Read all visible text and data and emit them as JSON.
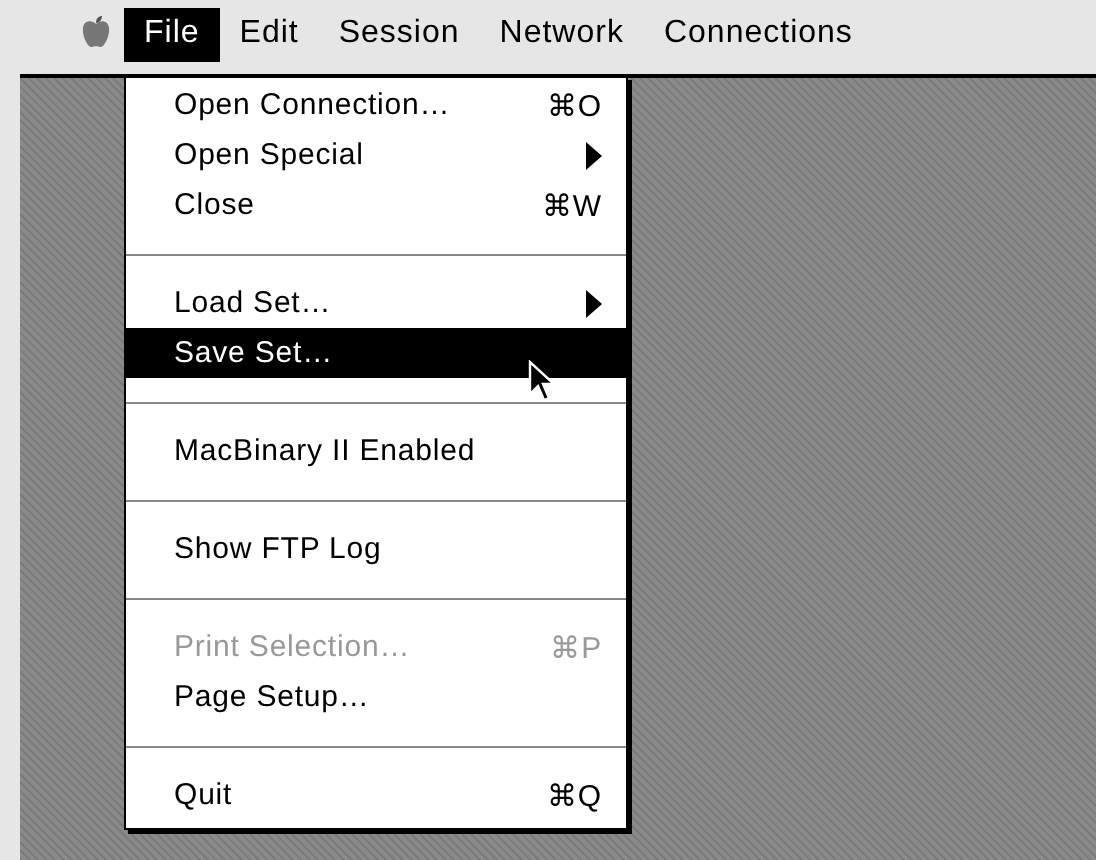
{
  "menu_bar": [
    {
      "label": "File",
      "selected": true
    },
    {
      "label": "Edit",
      "selected": false
    },
    {
      "label": "Session",
      "selected": false
    },
    {
      "label": "Network",
      "selected": false
    },
    {
      "label": "Connections",
      "selected": false
    }
  ],
  "file_menu": [
    {
      "kind": "item",
      "label": "Open Connection…",
      "shortcut": "⌘O",
      "submenu": false,
      "disabled": false,
      "selected": false
    },
    {
      "kind": "item",
      "label": "Open Special",
      "submenu": true,
      "disabled": false,
      "selected": false
    },
    {
      "kind": "item",
      "label": "Close",
      "shortcut": "⌘W",
      "submenu": false,
      "disabled": false,
      "selected": false
    },
    {
      "kind": "separator"
    },
    {
      "kind": "item",
      "label": "Load Set…",
      "submenu": true,
      "disabled": false,
      "selected": false
    },
    {
      "kind": "item",
      "label": "Save Set…",
      "submenu": false,
      "disabled": false,
      "selected": true
    },
    {
      "kind": "separator"
    },
    {
      "kind": "item",
      "label": "MacBinary II Enabled",
      "submenu": false,
      "disabled": false,
      "selected": false
    },
    {
      "kind": "separator"
    },
    {
      "kind": "item",
      "label": "Show FTP Log",
      "submenu": false,
      "disabled": false,
      "selected": false
    },
    {
      "kind": "separator"
    },
    {
      "kind": "item",
      "label": "Print Selection…",
      "shortcut": "⌘P",
      "submenu": false,
      "disabled": true,
      "selected": false
    },
    {
      "kind": "item",
      "label": "Page Setup…",
      "submenu": false,
      "disabled": false,
      "selected": false
    },
    {
      "kind": "separator"
    },
    {
      "kind": "item",
      "label": "Quit",
      "shortcut": "⌘Q",
      "submenu": false,
      "disabled": false,
      "selected": false
    }
  ]
}
